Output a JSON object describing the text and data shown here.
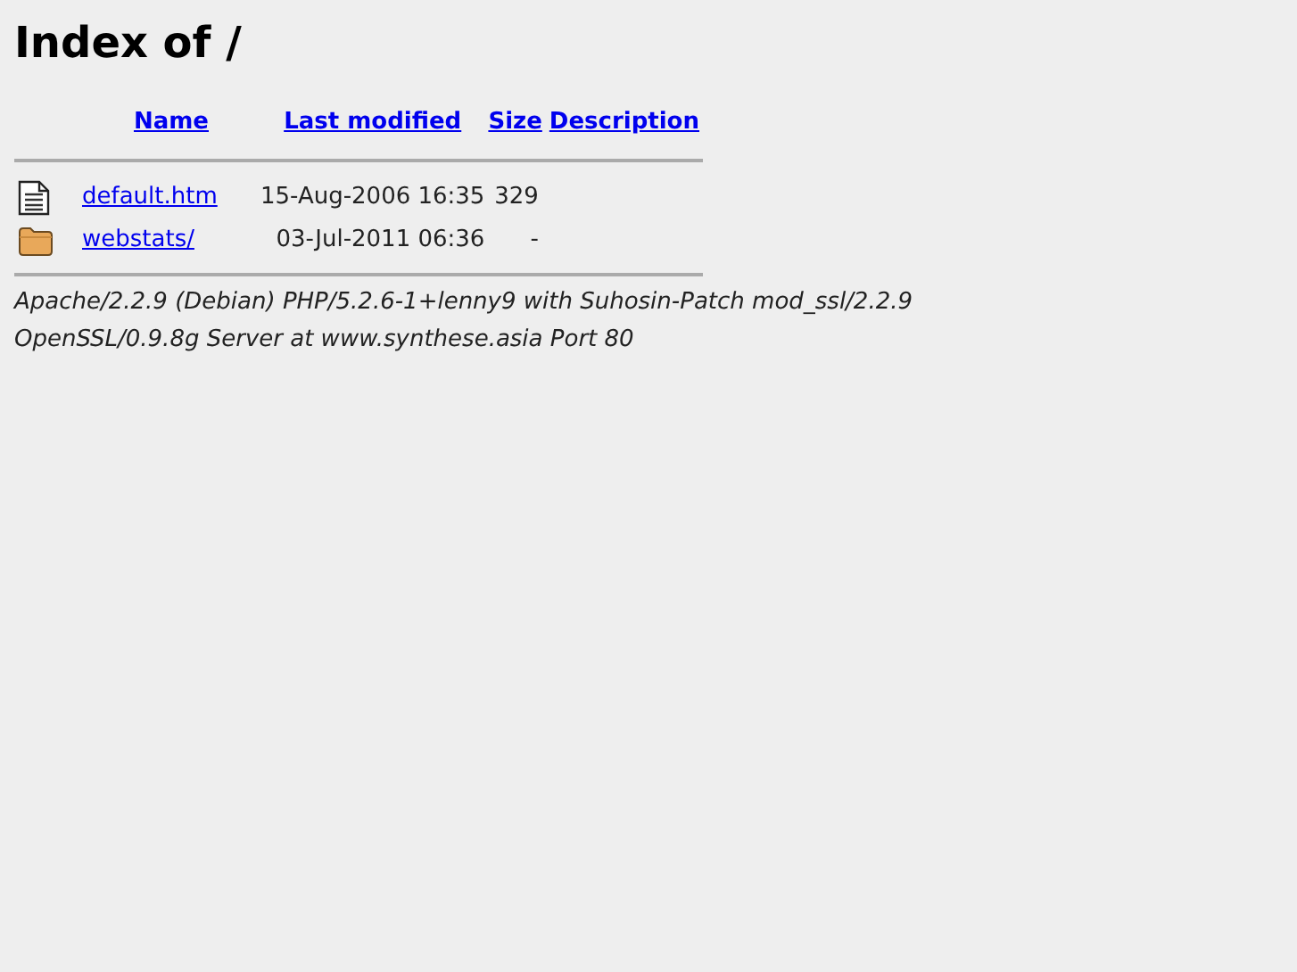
{
  "title": "Index of /",
  "columns": [
    "Name",
    "Last modified",
    "Size",
    "Description"
  ],
  "rows": [
    {
      "kind": "file",
      "name": "default.htm",
      "modified": "15-Aug-2006 16:35",
      "size": "329"
    },
    {
      "kind": "folder",
      "name": "webstats/",
      "modified": "03-Jul-2011 06:36",
      "size": "-"
    }
  ],
  "address": "Apache/2.2.9 (Debian) PHP/5.2.6-1+lenny9 with Suhosin-Patch mod_ssl/2.2.9 OpenSSL/0.9.8g Server at www.synthese.asia Port 80"
}
